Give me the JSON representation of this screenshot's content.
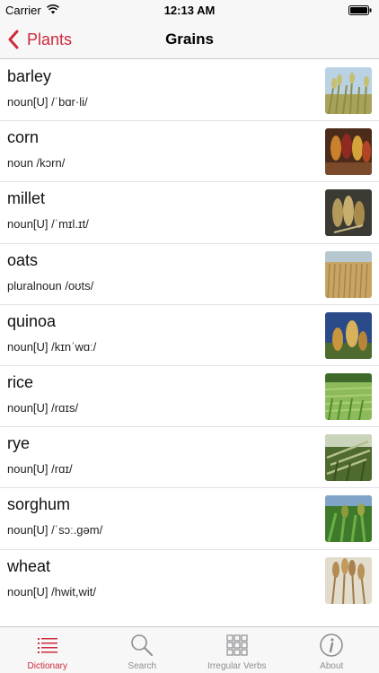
{
  "status": {
    "carrier": "Carrier",
    "time": "12:13 AM"
  },
  "nav": {
    "back_label": "Plants",
    "title": "Grains"
  },
  "words": [
    {
      "title": "barley",
      "sub": "noun[U] /ˈbɑr·li/",
      "image": "barley-photo"
    },
    {
      "title": "corn",
      "sub": "noun /kɔrn/",
      "image": "corn-photo"
    },
    {
      "title": "millet",
      "sub": "noun[U] /ˈmɪl.ɪt/",
      "image": "millet-photo"
    },
    {
      "title": "oats",
      "sub": "pluralnoun /oʊts/",
      "image": "oats-photo"
    },
    {
      "title": "quinoa",
      "sub": "noun[U] /kɪnˈwɑː/",
      "image": "quinoa-photo"
    },
    {
      "title": "rice",
      "sub": "noun[U] /rɑɪs/",
      "image": "rice-photo"
    },
    {
      "title": "rye",
      "sub": "noun[U] /rɑɪ/",
      "image": "rye-photo"
    },
    {
      "title": "sorghum",
      "sub": "noun[U] /ˈsɔː.gəm/",
      "image": "sorghum-photo"
    },
    {
      "title": "wheat",
      "sub": "noun[U] /hwit,wit/",
      "image": "wheat-photo"
    }
  ],
  "tabs": [
    {
      "label": "Dictionary",
      "icon": "list-icon",
      "active": true
    },
    {
      "label": "Search",
      "icon": "magnifier-icon",
      "active": false
    },
    {
      "label": "Irregular Verbs",
      "icon": "grid-icon",
      "active": false
    },
    {
      "label": "About",
      "icon": "info-icon",
      "active": false
    }
  ],
  "colors": {
    "accent": "#cd2a3d",
    "inactive": "#8e8e93",
    "bar_bg": "#f7f7f7"
  }
}
